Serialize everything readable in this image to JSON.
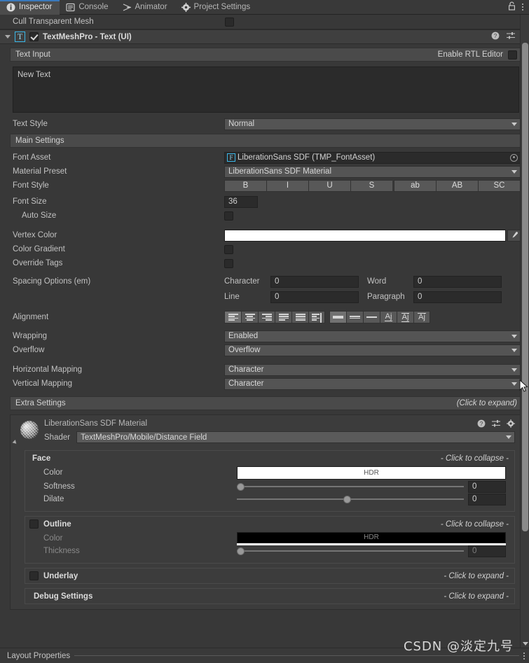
{
  "window": {
    "tabs": [
      {
        "label": "Inspector",
        "icon": "info-icon",
        "active": true
      },
      {
        "label": "Console",
        "icon": "console-icon",
        "active": false
      },
      {
        "label": "Animator",
        "icon": "animator-icon",
        "active": false
      },
      {
        "label": "Project Settings",
        "icon": "gear-icon",
        "active": false
      }
    ],
    "lock_icon": "lock-icon",
    "menu_icon": "kebab-menu-icon"
  },
  "cull_row": {
    "label": "Cull Transparent Mesh",
    "checked": false
  },
  "component": {
    "title": "TextMeshPro - Text (UI)",
    "badge": "T",
    "enabled": true,
    "help_icon": "help-icon",
    "preset_icon": "preset-icon",
    "menu_icon": "kebab-menu-icon"
  },
  "text_input": {
    "section_label": "Text Input",
    "rtl_label": "Enable RTL Editor",
    "rtl_checked": false,
    "value": "New Text",
    "text_style_label": "Text Style",
    "text_style_value": "Normal"
  },
  "main_settings": {
    "section_label": "Main Settings",
    "font_asset": {
      "label": "Font Asset",
      "value": "LiberationSans SDF (TMP_FontAsset)",
      "badge": "F",
      "picker_icon": "object-picker-icon"
    },
    "material_preset": {
      "label": "Material Preset",
      "value": "LiberationSans SDF Material"
    },
    "font_style": {
      "label": "Font Style",
      "options": [
        "B",
        "I",
        "U",
        "S",
        "ab",
        "AB",
        "SC"
      ]
    },
    "font_size": {
      "label": "Font Size",
      "value": "36"
    },
    "auto_size": {
      "label": "Auto Size",
      "checked": false
    },
    "vertex_color": {
      "label": "Vertex Color",
      "color": "#ffffff",
      "eyedropper_icon": "eyedropper-icon"
    },
    "color_gradient": {
      "label": "Color Gradient",
      "checked": false
    },
    "override_tags": {
      "label": "Override Tags",
      "checked": false
    },
    "spacing": {
      "label": "Spacing Options (em)",
      "character_label": "Character",
      "character_value": "0",
      "word_label": "Word",
      "word_value": "0",
      "line_label": "Line",
      "line_value": "0",
      "paragraph_label": "Paragraph",
      "paragraph_value": "0"
    },
    "alignment": {
      "label": "Alignment",
      "horizontal_icons": [
        "align-left-icon",
        "align-center-icon",
        "align-right-icon",
        "align-justified-icon",
        "align-flush-icon",
        "align-geometry-icon"
      ],
      "vertical_icons": [
        "valign-top-icon",
        "valign-middle-icon",
        "valign-bottom-icon",
        "valign-baseline-icon",
        "valign-midline-icon",
        "valign-capline-icon"
      ],
      "selected_horizontal": 0,
      "selected_vertical": 0
    },
    "wrapping": {
      "label": "Wrapping",
      "value": "Enabled"
    },
    "overflow": {
      "label": "Overflow",
      "value": "Overflow"
    },
    "horizontal_mapping": {
      "label": "Horizontal Mapping",
      "value": "Character"
    },
    "vertical_mapping": {
      "label": "Vertical Mapping",
      "value": "Character"
    }
  },
  "extra_settings": {
    "label": "Extra Settings",
    "hint": "(Click to expand)"
  },
  "material": {
    "name": "LiberationSans SDF Material",
    "help_icon": "help-icon",
    "preset_icon": "preset-icon",
    "gear_icon": "gear-icon",
    "shader_label": "Shader",
    "shader_value": "TextMeshPro/Mobile/Distance Field",
    "face": {
      "title": "Face",
      "hint": "- Click to collapse -",
      "color_label": "Color",
      "color_value": "#ffffff",
      "hdr_label": "HDR",
      "softness_label": "Softness",
      "softness_value": "0",
      "softness_pct": 0,
      "dilate_label": "Dilate",
      "dilate_value": "0",
      "dilate_pct": 50
    },
    "outline": {
      "title": "Outline",
      "enabled": false,
      "hint": "- Click to collapse -",
      "color_label": "Color",
      "color_value": "#000000",
      "hdr_label": "HDR",
      "thickness_label": "Thickness",
      "thickness_value": "0",
      "thickness_pct": 0
    },
    "underlay": {
      "title": "Underlay",
      "enabled": false,
      "hint": "- Click to expand -"
    },
    "debug": {
      "title": "Debug Settings",
      "hint": "- Click to expand -"
    }
  },
  "footer": {
    "label": "Layout Properties",
    "menu_icon": "kebab-menu-icon"
  },
  "watermark": "CSDN @淡定九号"
}
